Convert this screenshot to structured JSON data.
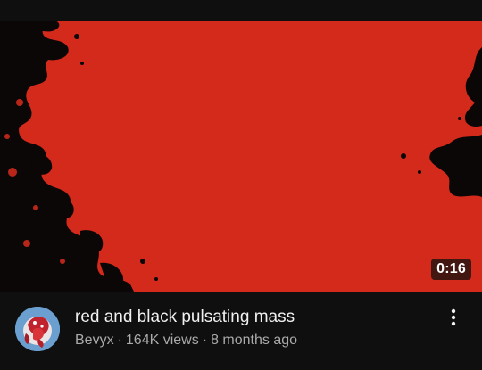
{
  "video": {
    "duration": "0:16",
    "title": "red and black pulsating mass",
    "channel": "Bevyx",
    "views": "164K views",
    "age": "8 months ago",
    "separator": "·"
  },
  "icons": {
    "menu": "more-vert-icon",
    "avatar": "channel-avatar"
  },
  "colors": {
    "background": "#0f0f0f",
    "thumbnail_red": "#d42a1c",
    "title_text": "#f1f1f1",
    "secondary_text": "#aaaaaa"
  }
}
